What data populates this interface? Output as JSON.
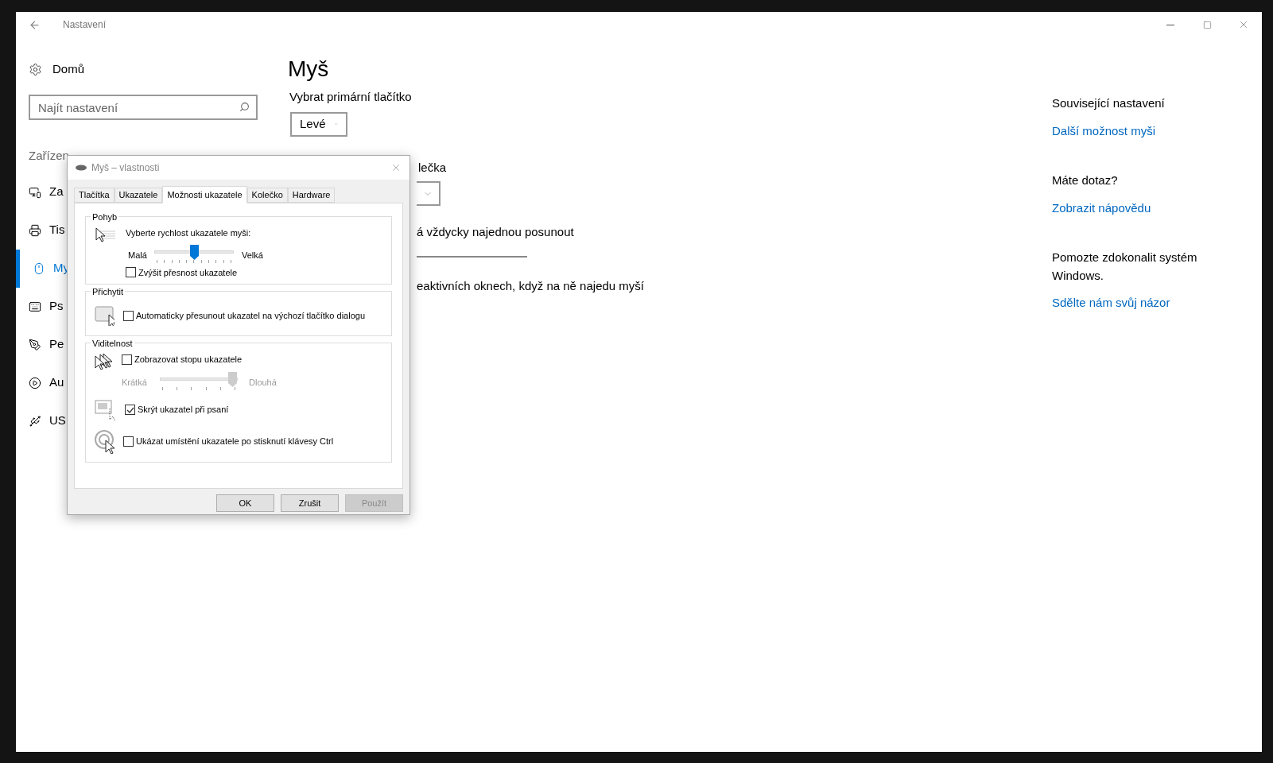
{
  "window": {
    "title": "Nastavení"
  },
  "sidebar": {
    "home": "Domů",
    "search": {
      "placeholder": "Najít nastavení"
    },
    "section": "Zařízen",
    "items": [
      {
        "label": "Za",
        "selected": false
      },
      {
        "label": "Tis",
        "selected": false
      },
      {
        "label": "My",
        "selected": true
      },
      {
        "label": "Ps",
        "selected": false
      },
      {
        "label": "Pe",
        "selected": false
      },
      {
        "label": "Au",
        "selected": false
      },
      {
        "label": "US",
        "selected": false
      }
    ]
  },
  "main": {
    "title": "Myš",
    "primary_button": {
      "label": "Vybrat primární tlačítko",
      "value": "Levé"
    },
    "wheel_label": "lečka",
    "scroll_label": "á vždycky najednou posunout",
    "inactive_label": "eaktivních oknech, když na ně najedu myší"
  },
  "related": [
    {
      "heading": "Související nastavení",
      "link": "Další možnost myši"
    },
    {
      "heading": "Máte dotaz?",
      "link": "Zobrazit nápovědu"
    },
    {
      "heading": "Pomozte zdokonalit systém Windows.",
      "link": "Sdělte nám svůj názor"
    }
  ],
  "dialog": {
    "title": "Myš – vlastnosti",
    "tabs": [
      {
        "label": "Tlačítka",
        "selected": false
      },
      {
        "label": "Ukazatele",
        "selected": false
      },
      {
        "label": "Možnosti ukazatele",
        "selected": true
      },
      {
        "label": "Kolečko",
        "selected": false
      },
      {
        "label": "Hardware",
        "selected": false
      }
    ],
    "motion": {
      "title": "Pohyb",
      "prompt": "Vyberte rychlost ukazatele myši:",
      "min": "Malá",
      "max": "Velká",
      "level": 0.5,
      "precision": {
        "label": "Zvýšit přesnost ukazatele",
        "checked": false
      }
    },
    "snap": {
      "title": "Přichytit",
      "option": {
        "label": "Automaticky přesunout ukazatel na výchozí tlačítko dialogu",
        "checked": false
      }
    },
    "visibility": {
      "title": "Viditelnost",
      "trails": {
        "label": "Zobrazovat stopu ukazatele",
        "checked": false
      },
      "trail_slider": {
        "min": "Krátká",
        "max": "Dlouhá",
        "level": 1,
        "disabled": true
      },
      "hide": {
        "label": "Skrýt ukazatel při psaní",
        "checked": true
      },
      "ctrl": {
        "label": "Ukázat umístění ukazatele po stisknutí klávesy Ctrl",
        "checked": false
      }
    },
    "buttons": [
      {
        "label": "OK",
        "disabled": false
      },
      {
        "label": "Zrušit",
        "disabled": false
      },
      {
        "label": "Použít",
        "disabled": true
      }
    ]
  }
}
